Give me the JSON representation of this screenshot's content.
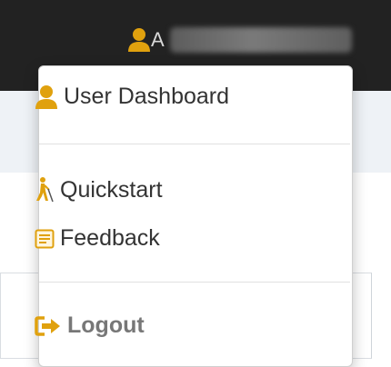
{
  "navbar": {
    "username_initial": "A"
  },
  "menu": {
    "items": [
      {
        "label": "User Dashboard",
        "icon": "user-icon"
      },
      {
        "label": "Quickstart",
        "icon": "walking-person-icon"
      },
      {
        "label": "Feedback",
        "icon": "feedback-form-icon"
      },
      {
        "label": "Logout",
        "icon": "logout-icon"
      }
    ]
  },
  "colors": {
    "accent": "#e0a10e",
    "navbar_bg": "#222222",
    "menu_text": "#333333",
    "logout_text": "#777777"
  }
}
